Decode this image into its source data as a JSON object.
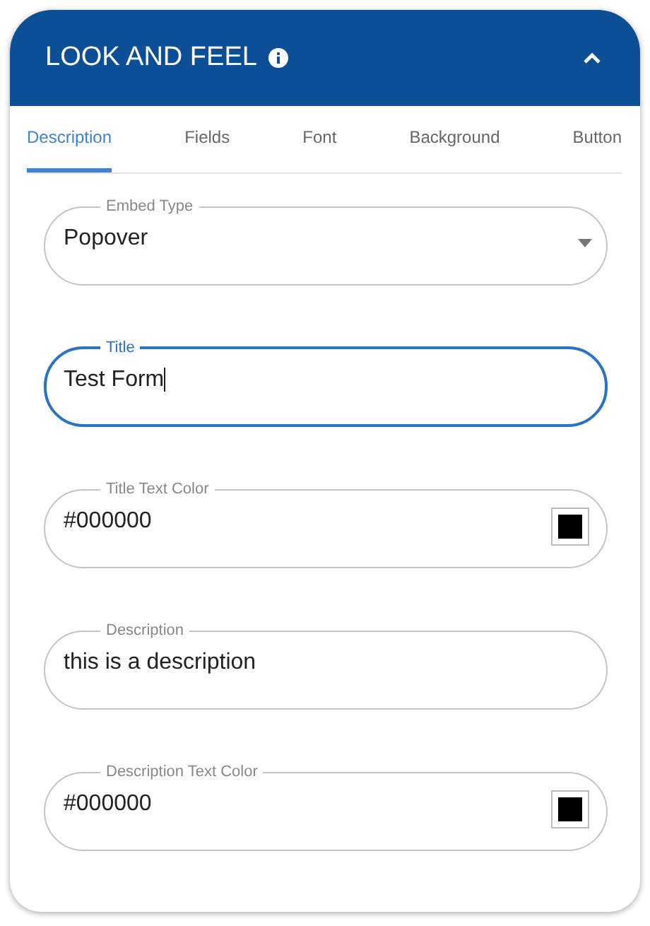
{
  "panel": {
    "title": "LOOK AND FEEL",
    "expanded": true
  },
  "tabs": [
    {
      "label": "Description",
      "selected": true
    },
    {
      "label": "Fields",
      "selected": false
    },
    {
      "label": "Font",
      "selected": false
    },
    {
      "label": "Background",
      "selected": false
    },
    {
      "label": "Button",
      "selected": false
    }
  ],
  "fields": [
    {
      "kind": "select",
      "label": "Embed Type",
      "value": "Popover",
      "focused": false
    },
    {
      "kind": "text",
      "label": "Title",
      "value": "Test Form",
      "focused": true
    },
    {
      "kind": "color",
      "label": "Title Text Color",
      "value": "#000000",
      "color": "#000000",
      "focused": false
    },
    {
      "kind": "text",
      "label": "Description",
      "value": "this is a description",
      "focused": false
    },
    {
      "kind": "color",
      "label": "Description Text Color",
      "value": "#000000",
      "color": "#000000",
      "focused": false
    }
  ]
}
